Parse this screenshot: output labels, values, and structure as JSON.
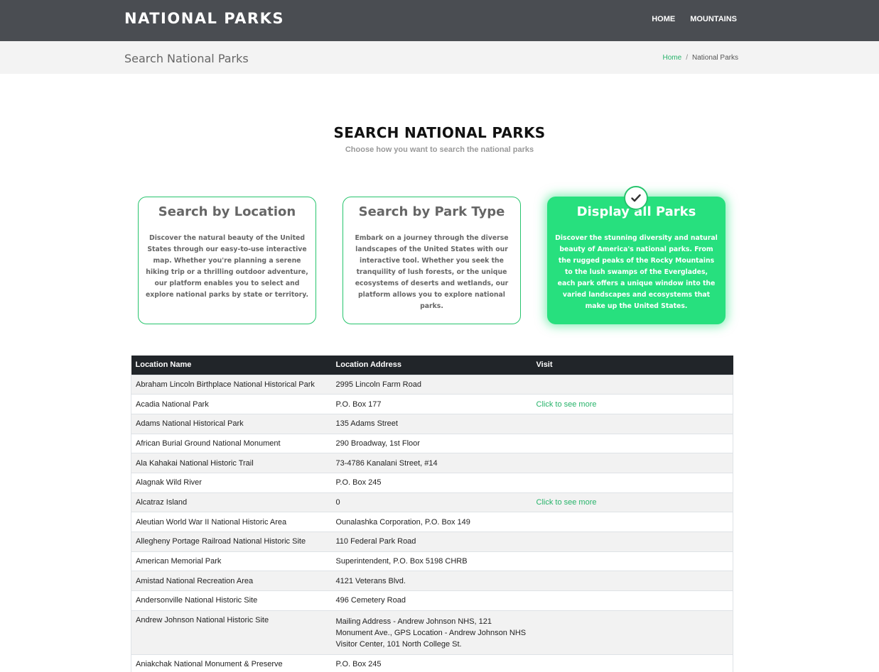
{
  "header": {
    "brand": "NATIONAL PARKS",
    "nav": [
      "HOME",
      "MOUNTAINS"
    ]
  },
  "subheader": {
    "title": "Search National Parks",
    "breadcrumb": {
      "home": "Home",
      "separator": "/",
      "current": "National Parks"
    }
  },
  "intro": {
    "title": "SEARCH NATIONAL PARKS",
    "subtitle": "Choose how you want to search the national parks"
  },
  "cards": [
    {
      "title": "Search by Location",
      "text": "Discover the natural beauty of the United States through our easy-to-use interactive map. Whether you're planning a serene hiking trip or a thrilling outdoor adventure, our platform enables you to select and explore national parks by state or territory."
    },
    {
      "title": "Search by Park Type",
      "text": "Embark on a journey through the diverse landscapes of the United States with our interactive tool. Whether you seek the tranquility of lush forests, or the unique ecosystems of deserts and wetlands, our platform allows you to explore national parks."
    },
    {
      "title": "Display all Parks",
      "text": "Discover the stunning diversity and natural beauty of America's national parks. From the rugged peaks of the Rocky Mountains to the lush swamps of the Everglades, each park offers a unique window into the varied landscapes and ecosystems that make up the United States.",
      "selected": true
    }
  ],
  "table": {
    "headers": [
      "Location Name",
      "Location Address",
      "Visit"
    ],
    "rows": [
      {
        "name": "Abraham Lincoln Birthplace National Historical Park",
        "address": "2995 Lincoln Farm Road",
        "visit": ""
      },
      {
        "name": "Acadia National Park",
        "address": "P.O. Box 177",
        "visit": "Click to see more"
      },
      {
        "name": "Adams National Historical Park",
        "address": "135 Adams Street",
        "visit": ""
      },
      {
        "name": "African Burial Ground National Monument",
        "address": "290 Broadway, 1st Floor",
        "visit": ""
      },
      {
        "name": "Ala Kahakai National Historic Trail",
        "address": "73-4786 Kanalani Street, #14",
        "visit": ""
      },
      {
        "name": "Alagnak Wild River",
        "address": "P.O. Box 245",
        "visit": ""
      },
      {
        "name": "Alcatraz Island",
        "address": "0",
        "visit": "Click to see more"
      },
      {
        "name": "Aleutian World War II National Historic Area",
        "address": "Ounalashka Corporation, P.O. Box 149",
        "visit": ""
      },
      {
        "name": "Allegheny Portage Railroad National Historic Site",
        "address": "110 Federal Park Road",
        "visit": ""
      },
      {
        "name": "American Memorial Park",
        "address": "Superintendent, P.O. Box 5198 CHRB",
        "visit": ""
      },
      {
        "name": "Amistad National Recreation Area",
        "address": "4121 Veterans Blvd.",
        "visit": ""
      },
      {
        "name": "Andersonville National Historic Site",
        "address": "496 Cemetery Road",
        "visit": ""
      },
      {
        "name": "Andrew Johnson National Historic Site",
        "address": "Mailing Address - Andrew Johnson NHS, 121 Monument Ave., GPS Location - Andrew Johnson NHS Visitor Center, 101 North College St.",
        "visit": ""
      },
      {
        "name": "Aniakchak National Monument & Preserve",
        "address": "P.O. Box 245",
        "visit": ""
      }
    ]
  },
  "colors": {
    "accent": "#27e07e",
    "link": "#27b36a",
    "topbar": "#4a4d52",
    "table_header": "#212529"
  },
  "icons": {
    "selected_card": "check-icon"
  }
}
